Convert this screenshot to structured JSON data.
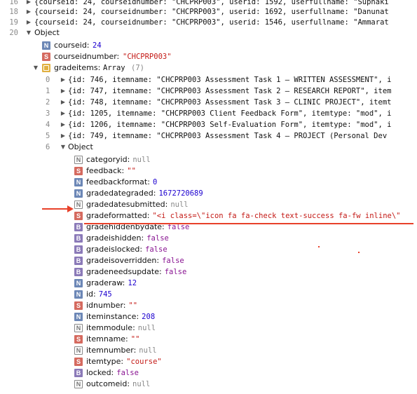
{
  "top_rows": [
    {
      "line": "16",
      "text": "{courseid: 24, courseidnumber: \"CHCPRP003\", userid: 1592, userfullname: \"Suphaki"
    },
    {
      "line": "18",
      "text": "{courseid: 24, courseidnumber: \"CHCPRP003\", userid: 1692, userfullname: \"Danunat"
    },
    {
      "line": "19",
      "text": "{courseid: 24, courseidnumber: \"CHCPRP003\", userid: 1546, userfullname: \"Ammarat"
    }
  ],
  "obj_line": "20",
  "obj_label": "Object",
  "courseid": {
    "key": "courseid:",
    "val": "24"
  },
  "courseidnumber": {
    "key": "courseidnumber:",
    "val": "\"CHCPRP003\""
  },
  "gradeitems": {
    "key": "gradeitems:",
    "type": "Array",
    "count": "(7)"
  },
  "items": [
    {
      "idx": "0",
      "text": "{id: 746, itemname: \"CHCPRP003 Assessment Task 1 – WRITTEN ASSESSMENT\", i"
    },
    {
      "idx": "1",
      "text": "{id: 747, itemname: \"CHCPRP003 Assessment Task 2 – RESEARCH REPORT\", item"
    },
    {
      "idx": "2",
      "text": "{id: 748, itemname: \"CHCPRP003 Assessment Task 3 – CLINIC PROJECT\", itemt"
    },
    {
      "idx": "3",
      "text": "{id: 1205, itemname: \"CHCPRP003 Client Feedback Form\", itemtype: \"mod\", i"
    },
    {
      "idx": "4",
      "text": "{id: 1206, itemname: \"CHCPRP003 Self-Evaluation Form\", itemtype: \"mod\", i"
    },
    {
      "idx": "5",
      "text": "{id: 749, itemname: \"CHCPRP003 Assessment Task 4   – PROJECT (Personal Dev"
    }
  ],
  "item6": {
    "idx": "6",
    "label": "Object"
  },
  "props": [
    {
      "badge": "N",
      "light": true,
      "key": "categoryid:",
      "val": "null",
      "cls": "null"
    },
    {
      "badge": "S",
      "key": "feedback:",
      "val": "\"\"",
      "cls": "str"
    },
    {
      "badge": "N",
      "key": "feedbackformat:",
      "val": "0",
      "cls": "num"
    },
    {
      "badge": "N",
      "key": "gradedategraded:",
      "val": "1672720689",
      "cls": "num"
    },
    {
      "badge": "N",
      "light": true,
      "key": "gradedatesubmitted:",
      "val": "null",
      "cls": "null"
    },
    {
      "badge": "S",
      "key": "gradeformatted:",
      "val": "\"<i class=\\\"icon fa fa-check text-success fa-fw inline\\\"",
      "cls": "str"
    },
    {
      "badge": "B",
      "key": "gradehiddenbydate:",
      "val": "false",
      "cls": "kw"
    },
    {
      "badge": "B",
      "key": "gradeishidden:",
      "val": "false",
      "cls": "kw"
    },
    {
      "badge": "B",
      "key": "gradeislocked:",
      "val": "false",
      "cls": "kw"
    },
    {
      "badge": "B",
      "key": "gradeisoverridden:",
      "val": "false",
      "cls": "kw"
    },
    {
      "badge": "B",
      "key": "gradeneedsupdate:",
      "val": "false",
      "cls": "kw"
    },
    {
      "badge": "N",
      "key": "graderaw:",
      "val": "12",
      "cls": "num"
    },
    {
      "badge": "N",
      "key": "id:",
      "val": "745",
      "cls": "num"
    },
    {
      "badge": "S",
      "key": "idnumber:",
      "val": "\"\"",
      "cls": "str"
    },
    {
      "badge": "N",
      "key": "iteminstance:",
      "val": "208",
      "cls": "num"
    },
    {
      "badge": "N",
      "light": true,
      "key": "itemmodule:",
      "val": "null",
      "cls": "null"
    },
    {
      "badge": "S",
      "key": "itemname:",
      "val": "\"\"",
      "cls": "str"
    },
    {
      "badge": "N",
      "light": true,
      "key": "itemnumber:",
      "val": "null",
      "cls": "null"
    },
    {
      "badge": "S",
      "key": "itemtype:",
      "val": "\"course\"",
      "cls": "str"
    },
    {
      "badge": "B",
      "key": "locked:",
      "val": "false",
      "cls": "kw"
    },
    {
      "badge": "N",
      "light": true,
      "key": "outcomeid:",
      "val": "null",
      "cls": "null"
    }
  ],
  "colors": {
    "annotation": "#e8412a",
    "string": "#c41a16",
    "number": "#1c00cf",
    "keyword": "#881391"
  }
}
